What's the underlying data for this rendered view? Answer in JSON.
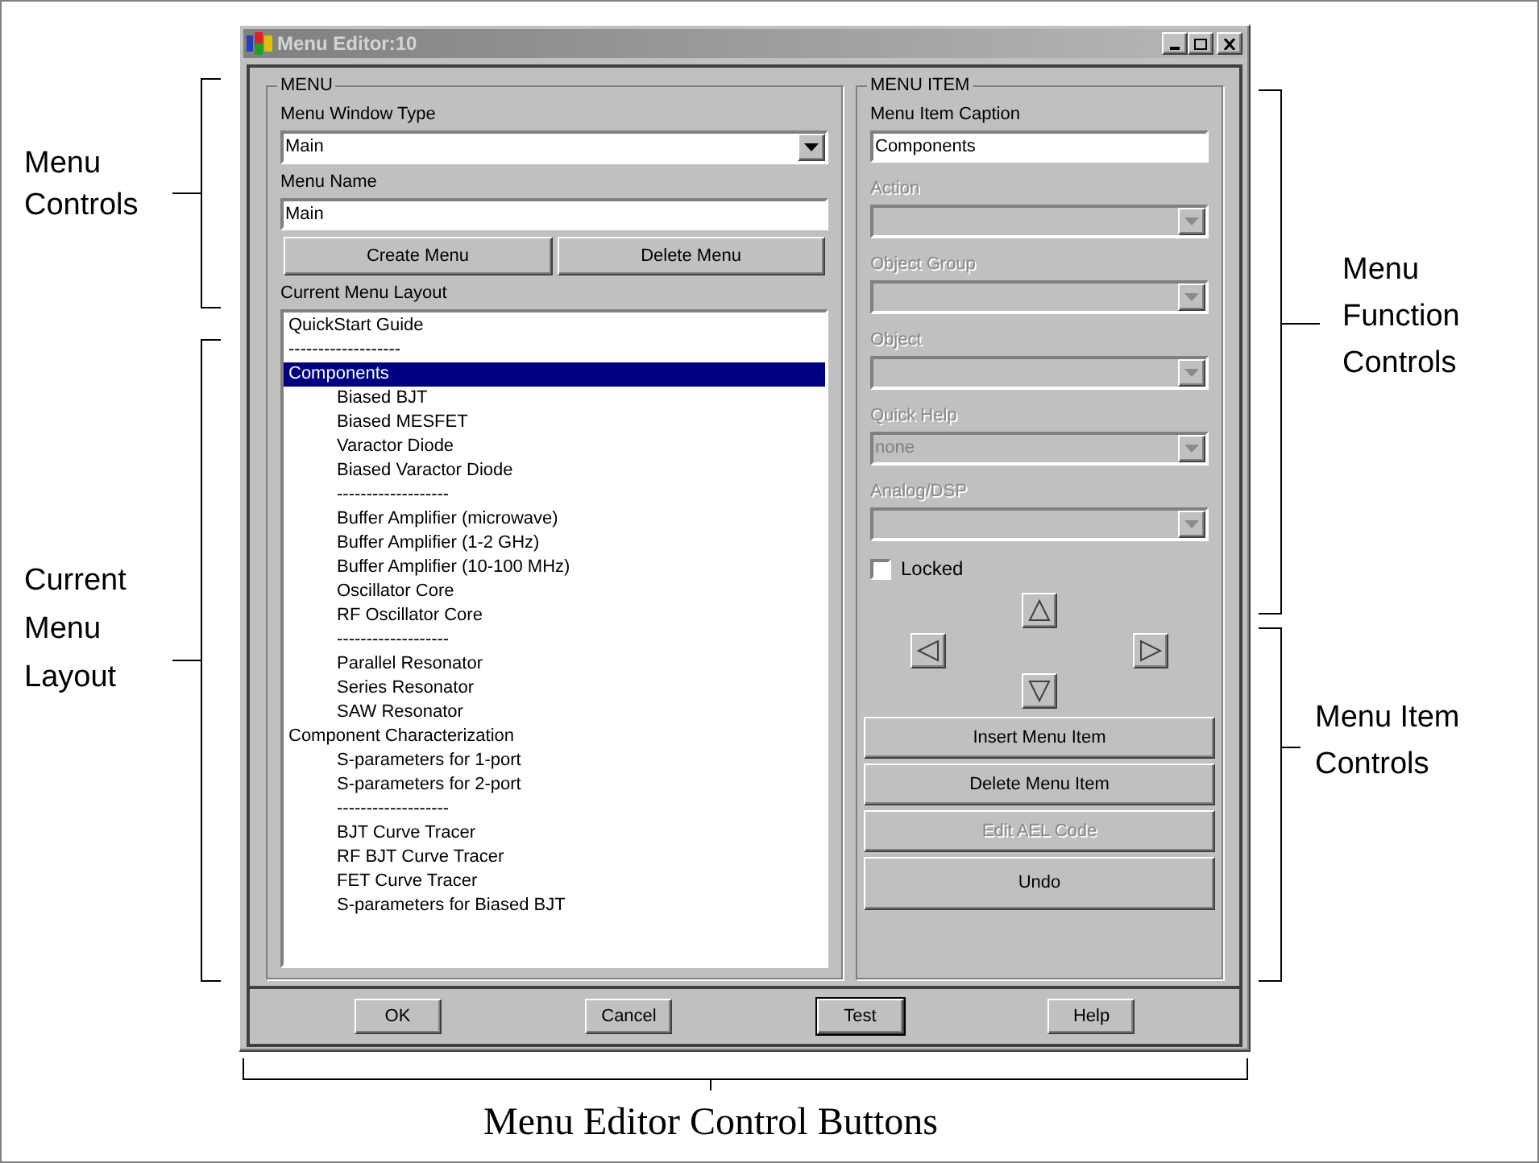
{
  "window": {
    "title": "Menu Editor:10"
  },
  "menu": {
    "title": "MENU",
    "window_type": {
      "label": "Menu Window Type",
      "value": "Main"
    },
    "menu_name": {
      "label": "Menu Name",
      "value": "Main"
    },
    "buttons": [
      {
        "label": "Create Menu"
      },
      {
        "label": "Delete Menu"
      }
    ],
    "layout": {
      "label": "Current Menu Layout",
      "items": [
        {
          "text": "QuickStart Guide",
          "selected": false
        },
        {
          "text": "-------------------",
          "selected": false
        },
        {
          "text": "Components",
          "selected": true,
          "children": [
            {
              "text": "Biased BJT",
              "selected": false
            },
            {
              "text": "Biased MESFET",
              "selected": false
            },
            {
              "text": "Varactor Diode",
              "selected": false
            },
            {
              "text": "Biased Varactor Diode",
              "selected": false
            },
            {
              "text": "-------------------",
              "selected": false
            },
            {
              "text": "Buffer Amplifier (microwave)",
              "selected": false
            },
            {
              "text": "Buffer Amplifier (1-2 GHz)",
              "selected": false
            },
            {
              "text": "Buffer Amplifier (10-100 MHz)",
              "selected": false
            },
            {
              "text": "Oscillator Core",
              "selected": false
            },
            {
              "text": "RF Oscillator Core",
              "selected": false
            },
            {
              "text": "-------------------",
              "selected": false
            },
            {
              "text": "Parallel Resonator",
              "selected": false
            },
            {
              "text": "Series Resonator",
              "selected": false
            },
            {
              "text": "SAW Resonator",
              "selected": false
            }
          ]
        },
        {
          "text": "Component Characterization",
          "selected": false,
          "children": [
            {
              "text": "S-parameters for 1-port",
              "selected": false
            },
            {
              "text": "S-parameters for 2-port",
              "selected": false
            },
            {
              "text": "-------------------",
              "selected": false
            },
            {
              "text": "BJT Curve Tracer",
              "selected": false
            },
            {
              "text": "RF BJT Curve Tracer",
              "selected": false
            },
            {
              "text": "FET Curve Tracer",
              "selected": false
            },
            {
              "text": "S-parameters for Biased BJT",
              "selected": false
            }
          ]
        }
      ]
    }
  },
  "menu_item": {
    "title": "MENU ITEM",
    "caption": {
      "label": "Menu Item Caption",
      "value": "Components"
    },
    "dropdowns": [
      {
        "label": "Action",
        "disabled": true
      },
      {
        "label": "Object Group",
        "disabled": true
      },
      {
        "label": "Object",
        "disabled": true
      },
      {
        "label": "Quick Help",
        "value": "none",
        "disabled": true
      },
      {
        "label": "Analog/DSP",
        "disabled": true
      }
    ],
    "locked": {
      "label": "Locked",
      "checked": false
    },
    "buttons": [
      {
        "label": "Insert Menu Item",
        "disabled": false
      },
      {
        "label": "Delete Menu Item",
        "disabled": false
      },
      {
        "label": "Edit AEL Code",
        "disabled": true
      },
      {
        "label": "Undo",
        "disabled": false
      }
    ]
  },
  "footer_buttons": [
    {
      "label": "OK",
      "default": false
    },
    {
      "label": "Cancel",
      "default": false
    },
    {
      "label": "Test",
      "default": true
    },
    {
      "label": "Help",
      "default": false
    }
  ],
  "annotations": {
    "menu_controls": "Menu Controls",
    "current_menu_layout": "Current Menu Layout",
    "menu_function_controls": "Menu Function Controls",
    "menu_item_controls": "Menu Item Controls",
    "control_buttons": "Menu Editor Control Buttons"
  }
}
